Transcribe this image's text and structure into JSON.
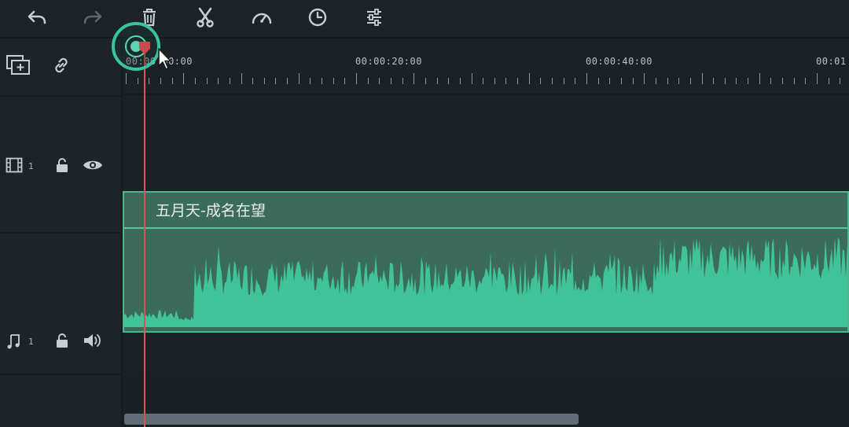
{
  "toolbar": {
    "icons": [
      "undo-icon",
      "redo-icon",
      "delete-icon",
      "cut-icon",
      "speed-icon",
      "duration-icon",
      "adjust-icon"
    ]
  },
  "track_controls": {
    "header_icons": [
      "add-track-icon",
      "link-icon"
    ],
    "video_track_number": "1",
    "audio_track_number": "1"
  },
  "ruler": {
    "labels": [
      "00:00:00:00",
      "00:00:20:00",
      "00:00:40:00",
      "00:01"
    ]
  },
  "audio_clip": {
    "title": "五月天-成名在望"
  },
  "colors": {
    "accent": "#3ac3a0",
    "playhead": "#d9534f",
    "clip_fill": "#3b6b5a",
    "waveform": "#41c39a"
  }
}
